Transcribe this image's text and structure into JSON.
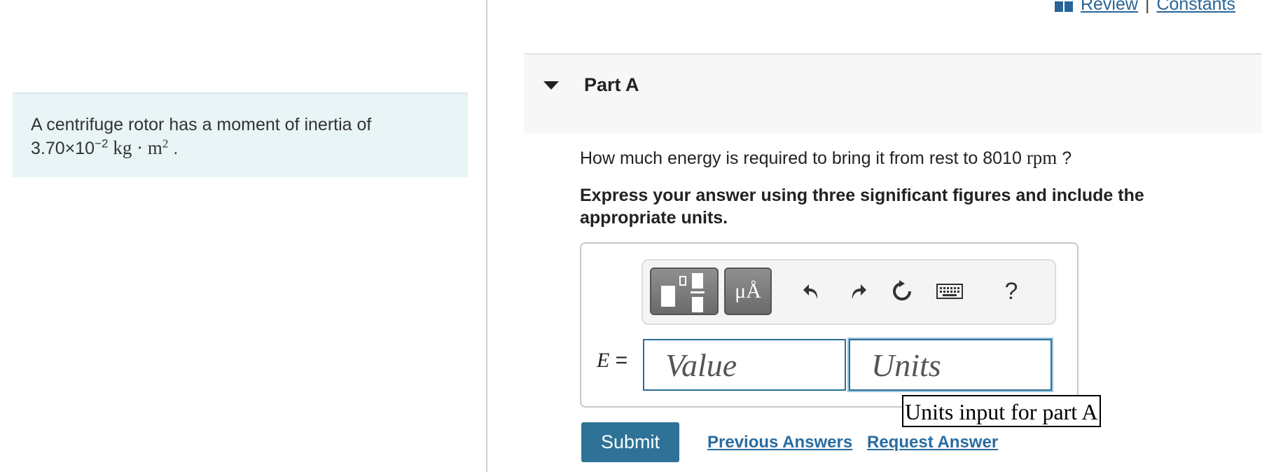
{
  "top_links": {
    "review": "Review",
    "separator": "|",
    "constants": "Constants"
  },
  "problem": {
    "text": "A centrifuge rotor has a moment of inertia of",
    "mantissa": "3.70×10",
    "exponent": "−2",
    "units_main": "kg · m",
    "units_exp": "2",
    "trailing": "."
  },
  "part": {
    "title": "Part A",
    "question_pre": "How much energy is required to bring it from rest to 8010",
    "question_unit": "rpm",
    "question_post": "?",
    "instructions": "Express your answer using three significant figures and include the appropriate units."
  },
  "toolbar": {
    "units_button_label": "μÅ",
    "help_label": "?",
    "icons": [
      "templates-icon",
      "units-icon",
      "undo-icon",
      "redo-icon",
      "reset-icon",
      "keyboard-icon",
      "help-icon"
    ]
  },
  "answer": {
    "variable": "E",
    "equals": "=",
    "value_placeholder": "Value",
    "units_placeholder": "Units",
    "tooltip": "Units input for part A"
  },
  "actions": {
    "submit": "Submit",
    "previous_answers": "Previous Answers",
    "request_answer": "Request Answer"
  },
  "colors": {
    "problem_bg": "#e8f4f6",
    "submit_bg": "#2e7397",
    "link": "#2a6ca0",
    "input_border": "#2b7096"
  }
}
